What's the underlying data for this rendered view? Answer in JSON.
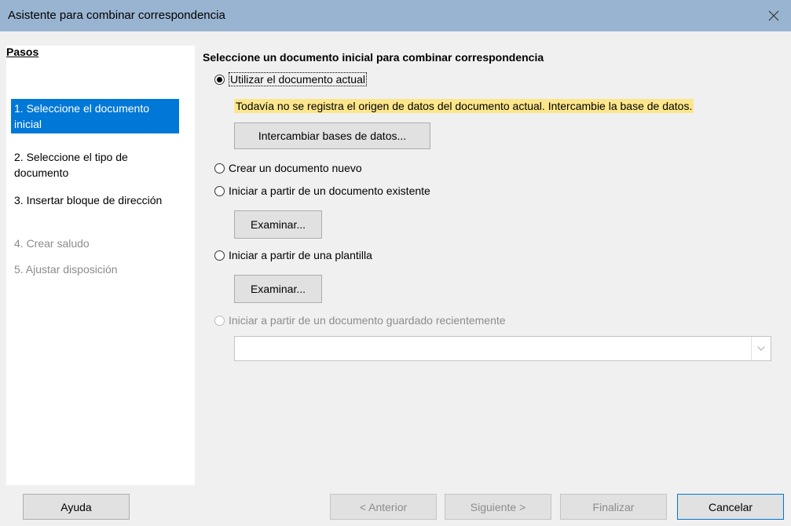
{
  "window": {
    "title": "Asistente para combinar correspondencia"
  },
  "sidebar": {
    "heading": "Pasos",
    "steps": [
      {
        "label": "1. Seleccione el documento inicial",
        "state": "active"
      },
      {
        "label": "2. Seleccione el tipo de documento",
        "state": "enabled"
      },
      {
        "label": "3. Insertar bloque de dirección",
        "state": "enabled"
      },
      {
        "label": "4. Crear saludo",
        "state": "disabled"
      },
      {
        "label": "5. Ajustar disposición",
        "state": "disabled"
      }
    ]
  },
  "main": {
    "title": "Seleccione un documento inicial para combinar correspondencia",
    "options": {
      "current": "Utilizar el documento actual",
      "new": "Crear un documento nuevo",
      "existing": "Iniciar a partir de un documento existente",
      "template": "Iniciar a partir de una plantilla",
      "recent": "Iniciar a partir de un documento guardado recientemente"
    },
    "selected_option": "current",
    "warning": "Todavía no se registra el origen de datos del documento actual. Intercambie la base de datos.",
    "exchange_db_button": "Intercambiar bases de datos...",
    "browse_button": "Examinar...",
    "recent_combo_value": ""
  },
  "footer": {
    "help": "Ayuda",
    "previous": "< Anterior",
    "next": "Siguiente >",
    "finish": "Finalizar",
    "cancel": "Cancelar"
  },
  "colors": {
    "titlebar": "#99b4d1",
    "active_step": "#0078d7",
    "warning_bg": "#fce68b"
  },
  "icons": {
    "close": "close-icon",
    "dropdown": "chevron-down-icon"
  }
}
